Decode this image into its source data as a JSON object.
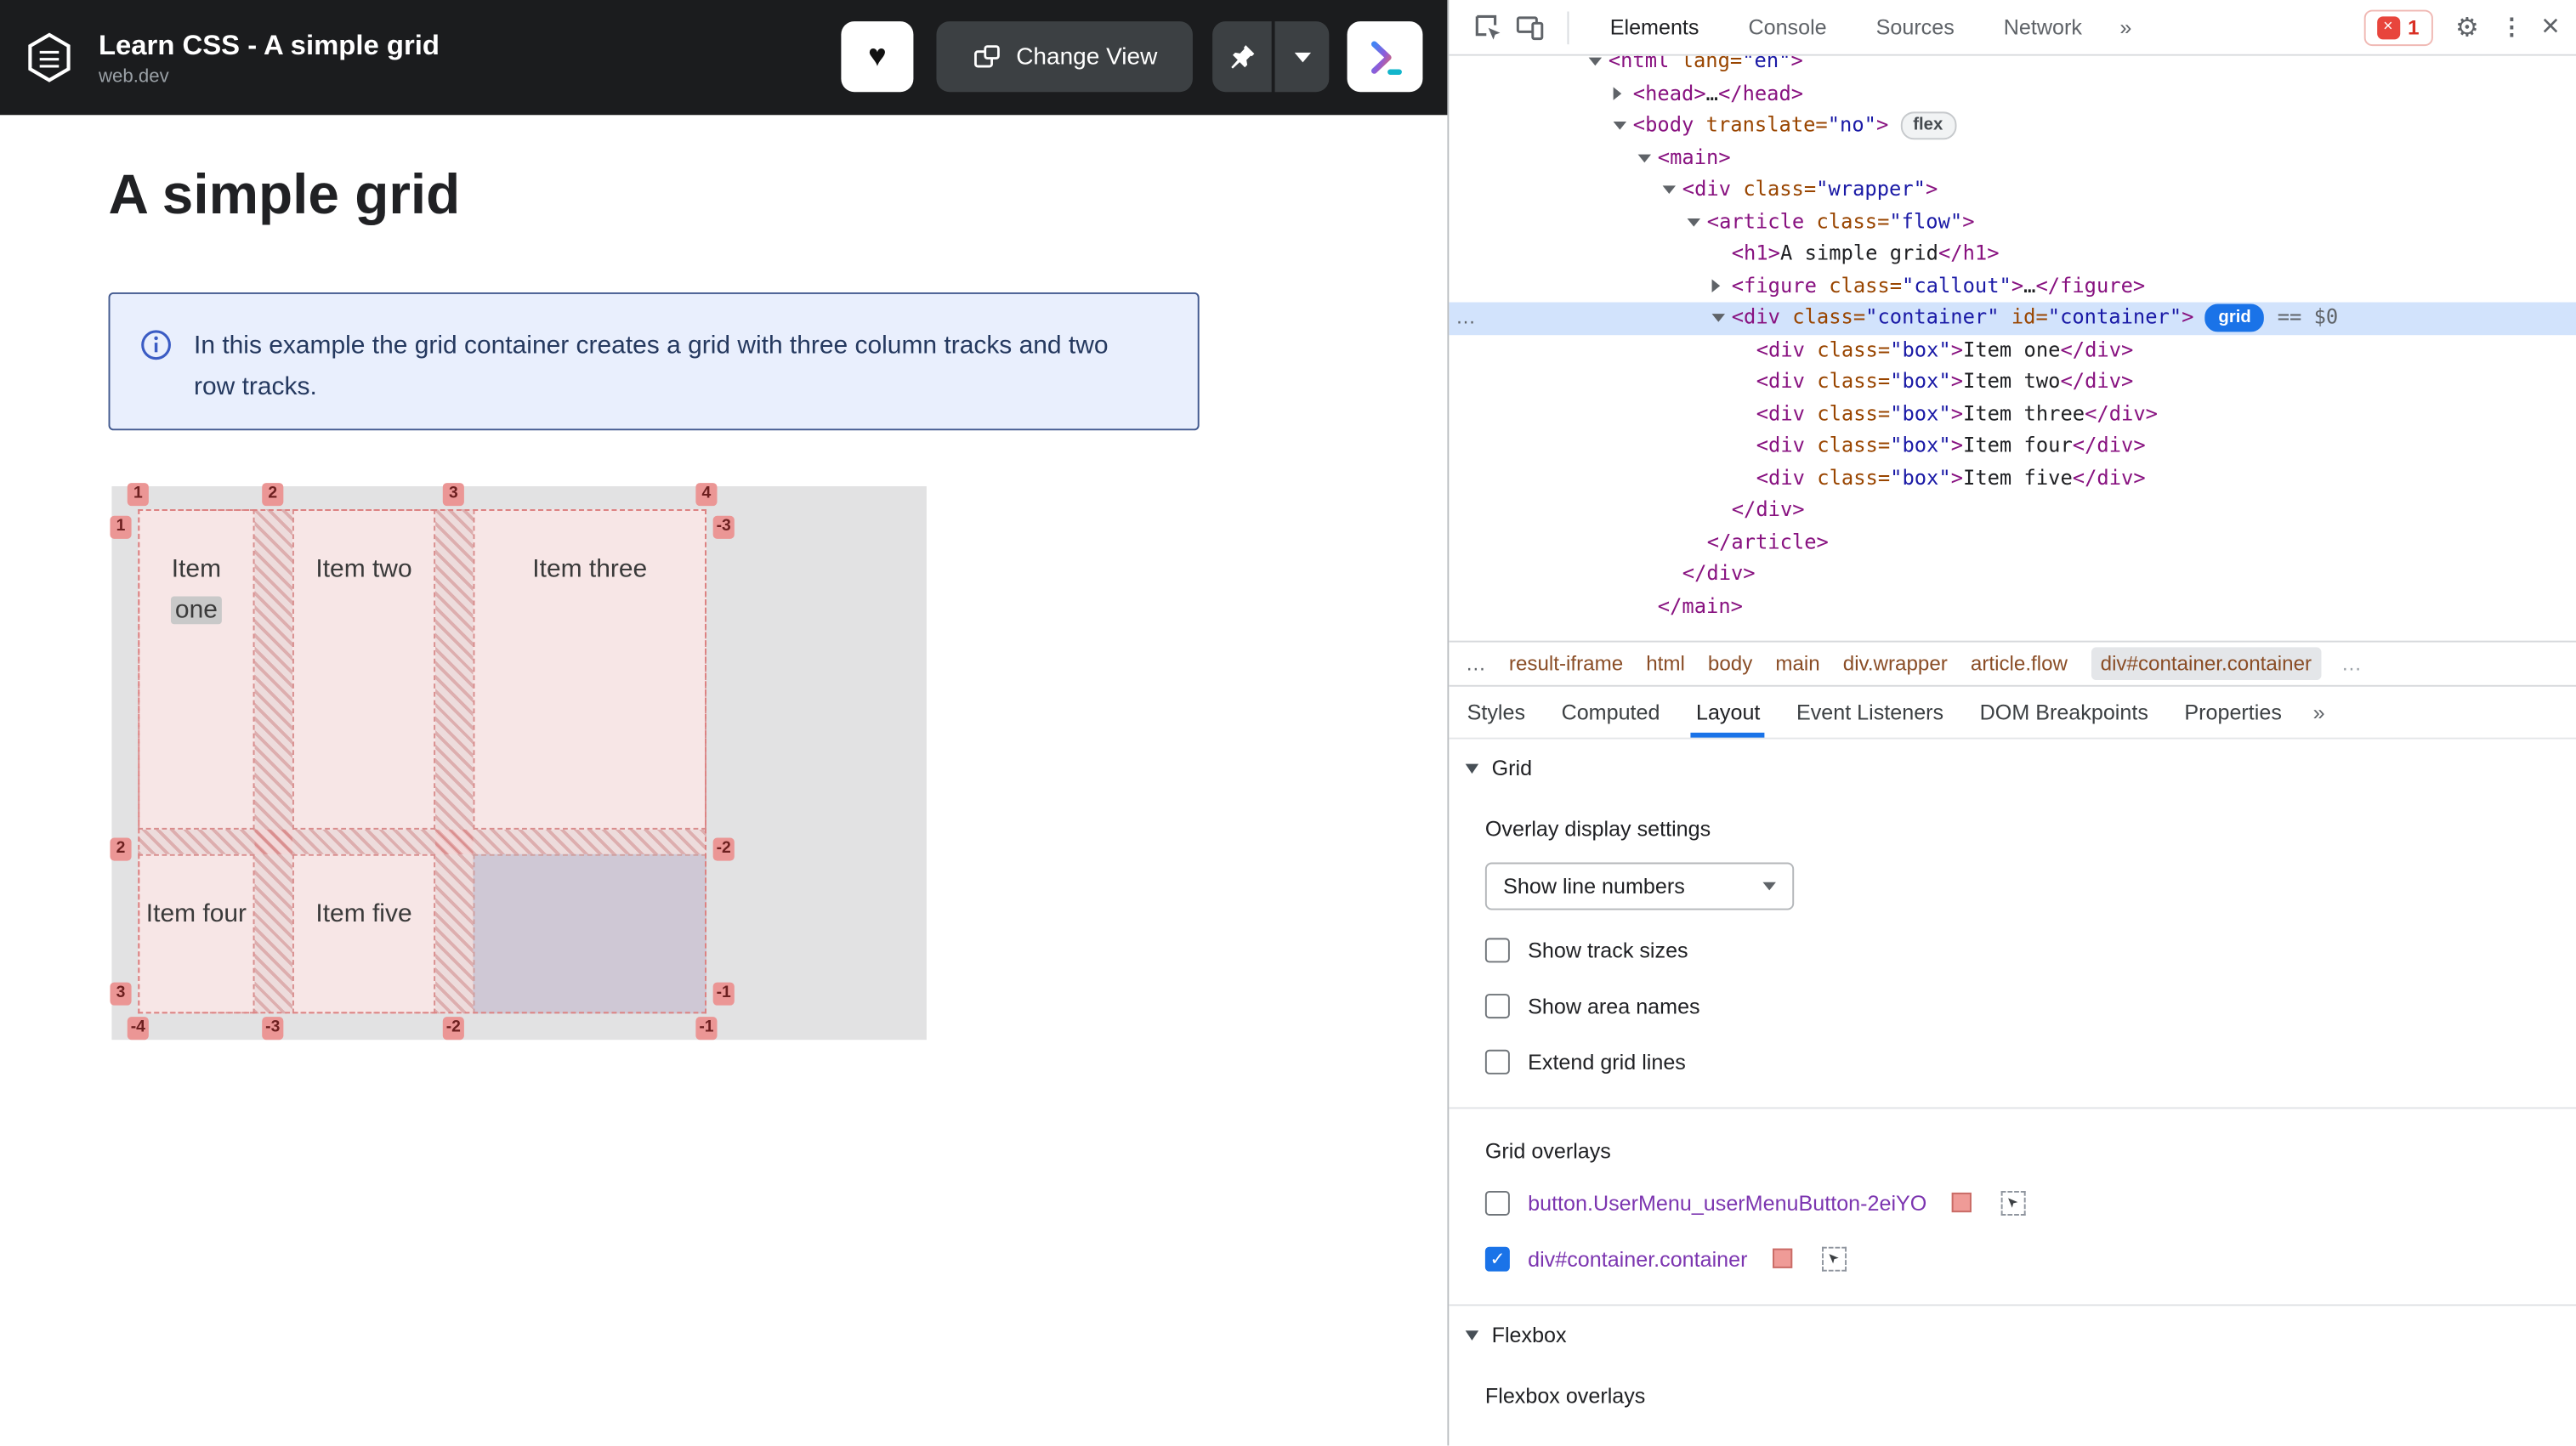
{
  "app": {
    "header": {
      "title": "Learn CSS - A simple grid",
      "subtitle": "web.dev",
      "change_view_label": "Change View"
    },
    "article": {
      "heading": "A simple grid",
      "callout_text": "In this example the grid container creates a grid with three column tracks and two row tracks."
    },
    "grid_preview": {
      "items": [
        {
          "word1": "Item",
          "word2": "one"
        },
        {
          "label": "Item two"
        },
        {
          "label": "Item three"
        },
        {
          "label": "Item four"
        },
        {
          "label": "Item five"
        }
      ],
      "top_badges": [
        "1",
        "2",
        "3",
        "4"
      ],
      "bottom_badges": [
        "-4",
        "-3",
        "-2",
        "-1"
      ],
      "left_badges": [
        "1",
        "2",
        "3"
      ],
      "right_badges": [
        "-3",
        "-2",
        "-1"
      ]
    }
  },
  "devtools": {
    "toolbar": {
      "tabs": [
        {
          "label": "Elements",
          "active": true
        },
        {
          "label": "Console",
          "active": false
        },
        {
          "label": "Sources",
          "active": false
        },
        {
          "label": "Network",
          "active": false
        }
      ],
      "more_tabs": "»",
      "error_count": "1"
    },
    "tree": [
      {
        "indent": 0,
        "arrow": "down",
        "segs": [
          {
            "c": "c",
            "t": "<html"
          },
          {
            "c": "a",
            "t": " lang="
          },
          {
            "c": "v",
            "t": "\"en\""
          },
          {
            "c": "c",
            "t": ">"
          }
        ]
      },
      {
        "indent": 1,
        "arrow": "right",
        "segs": [
          {
            "c": "c",
            "t": "<head>"
          },
          {
            "c": "e",
            "t": "…"
          },
          {
            "c": "c",
            "t": "</head>"
          }
        ]
      },
      {
        "indent": 1,
        "arrow": "down",
        "segs": [
          {
            "c": "c",
            "t": "<body"
          },
          {
            "c": "a",
            "t": " translate="
          },
          {
            "c": "v",
            "t": "\"no\""
          },
          {
            "c": "c",
            "t": ">"
          }
        ],
        "badge": "flex"
      },
      {
        "indent": 2,
        "arrow": "down",
        "segs": [
          {
            "c": "c",
            "t": "<main>"
          }
        ]
      },
      {
        "indent": 3,
        "arrow": "down",
        "segs": [
          {
            "c": "c",
            "t": "<div"
          },
          {
            "c": "a",
            "t": " class="
          },
          {
            "c": "v",
            "t": "\"wrapper\""
          },
          {
            "c": "c",
            "t": ">"
          }
        ]
      },
      {
        "indent": 4,
        "arrow": "down",
        "segs": [
          {
            "c": "c",
            "t": "<article"
          },
          {
            "c": "a",
            "t": " class="
          },
          {
            "c": "v",
            "t": "\"flow\""
          },
          {
            "c": "c",
            "t": ">"
          }
        ]
      },
      {
        "indent": 5,
        "segs": [
          {
            "c": "c",
            "t": "<h1>"
          },
          {
            "c": "t",
            "t": "A simple grid"
          },
          {
            "c": "c",
            "t": "</h1>"
          }
        ]
      },
      {
        "indent": 5,
        "arrow": "right",
        "segs": [
          {
            "c": "c",
            "t": "<figure"
          },
          {
            "c": "a",
            "t": " class="
          },
          {
            "c": "v",
            "t": "\"callout\""
          },
          {
            "c": "c",
            "t": ">"
          },
          {
            "c": "e",
            "t": "…"
          },
          {
            "c": "c",
            "t": "</figure>"
          }
        ]
      },
      {
        "indent": 5,
        "arrow": "down",
        "selected": true,
        "gutter": "…",
        "segs": [
          {
            "c": "c",
            "t": "<div"
          },
          {
            "c": "a",
            "t": " class="
          },
          {
            "c": "v",
            "t": "\"container\""
          },
          {
            "c": "a",
            "t": " id="
          },
          {
            "c": "v",
            "t": "\"container\""
          },
          {
            "c": "c",
            "t": ">"
          }
        ],
        "badge": "grid",
        "badge_active": true,
        "suffix": "== $0"
      },
      {
        "indent": 6,
        "segs": [
          {
            "c": "c",
            "t": "<div"
          },
          {
            "c": "a",
            "t": " class="
          },
          {
            "c": "v",
            "t": "\"box\""
          },
          {
            "c": "c",
            "t": ">"
          },
          {
            "c": "t",
            "t": "Item one"
          },
          {
            "c": "c",
            "t": "</div>"
          }
        ]
      },
      {
        "indent": 6,
        "segs": [
          {
            "c": "c",
            "t": "<div"
          },
          {
            "c": "a",
            "t": " class="
          },
          {
            "c": "v",
            "t": "\"box\""
          },
          {
            "c": "c",
            "t": ">"
          },
          {
            "c": "t",
            "t": "Item two"
          },
          {
            "c": "c",
            "t": "</div>"
          }
        ]
      },
      {
        "indent": 6,
        "segs": [
          {
            "c": "c",
            "t": "<div"
          },
          {
            "c": "a",
            "t": " class="
          },
          {
            "c": "v",
            "t": "\"box\""
          },
          {
            "c": "c",
            "t": ">"
          },
          {
            "c": "t",
            "t": "Item three"
          },
          {
            "c": "c",
            "t": "</div>"
          }
        ]
      },
      {
        "indent": 6,
        "segs": [
          {
            "c": "c",
            "t": "<div"
          },
          {
            "c": "a",
            "t": " class="
          },
          {
            "c": "v",
            "t": "\"box\""
          },
          {
            "c": "c",
            "t": ">"
          },
          {
            "c": "t",
            "t": "Item four"
          },
          {
            "c": "c",
            "t": "</div>"
          }
        ]
      },
      {
        "indent": 6,
        "segs": [
          {
            "c": "c",
            "t": "<div"
          },
          {
            "c": "a",
            "t": " class="
          },
          {
            "c": "v",
            "t": "\"box\""
          },
          {
            "c": "c",
            "t": ">"
          },
          {
            "c": "t",
            "t": "Item five"
          },
          {
            "c": "c",
            "t": "</div>"
          }
        ]
      },
      {
        "indent": 5,
        "segs": [
          {
            "c": "c",
            "t": "</div>"
          }
        ]
      },
      {
        "indent": 4,
        "segs": [
          {
            "c": "c",
            "t": "</article>"
          }
        ]
      },
      {
        "indent": 3,
        "segs": [
          {
            "c": "c",
            "t": "</div>"
          }
        ]
      },
      {
        "indent": 2,
        "segs": [
          {
            "c": "c",
            "t": "</main>"
          }
        ]
      }
    ],
    "breadcrumbs": {
      "leading": "…",
      "crumbs": [
        {
          "label": "result-iframe"
        },
        {
          "label": "html"
        },
        {
          "label": "body"
        },
        {
          "label": "main"
        },
        {
          "label": "div.wrapper"
        },
        {
          "label": "article.flow"
        },
        {
          "label": "div#container.container",
          "selected": true
        }
      ],
      "trailing": "…"
    },
    "sidebar_tabs": [
      {
        "label": "Styles"
      },
      {
        "label": "Computed"
      },
      {
        "label": "Layout",
        "active": true
      },
      {
        "label": "Event Listeners"
      },
      {
        "label": "DOM Breakpoints"
      },
      {
        "label": "Properties"
      }
    ],
    "sidebar_more": "»",
    "layout_pane": {
      "grid_header": "Grid",
      "overlay_settings_header": "Overlay display settings",
      "line_numbers_dropdown": "Show line numbers",
      "settings": [
        {
          "label": "Show track sizes",
          "checked": false
        },
        {
          "label": "Show area names",
          "checked": false
        },
        {
          "label": "Extend grid lines",
          "checked": false
        }
      ],
      "grid_overlays_header": "Grid overlays",
      "overlays": [
        {
          "label": "button.UserMenu_userMenuButton-2eiYO",
          "checked": false
        },
        {
          "label": "div#container.container",
          "checked": true
        }
      ],
      "flexbox_header": "Flexbox",
      "flexbox_overlays_header": "Flexbox overlays"
    }
  }
}
